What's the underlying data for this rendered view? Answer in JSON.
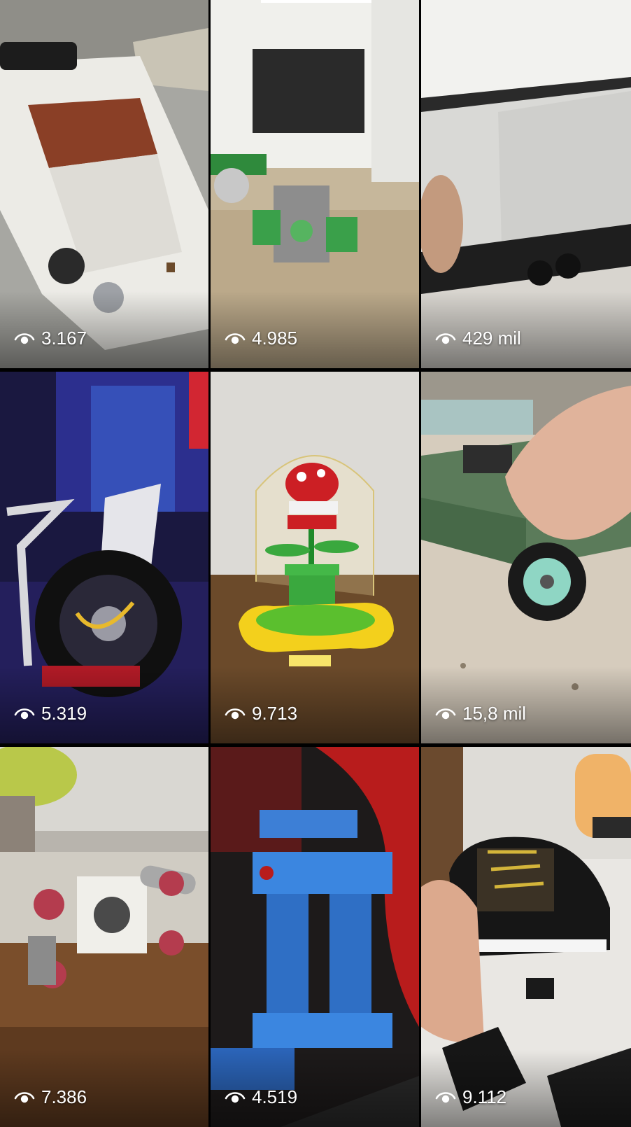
{
  "videos": [
    {
      "views": "3.167",
      "icon": "eye-icon"
    },
    {
      "views": "4.985",
      "icon": "eye-icon"
    },
    {
      "views": "429 mil",
      "icon": "eye-icon"
    },
    {
      "views": "5.319",
      "icon": "eye-icon"
    },
    {
      "views": "9.713",
      "icon": "eye-icon"
    },
    {
      "views": "15,8 mil",
      "icon": "eye-icon"
    },
    {
      "views": "7.386",
      "icon": "eye-icon"
    },
    {
      "views": "4.519",
      "icon": "eye-icon"
    },
    {
      "views": "9.112",
      "icon": "eye-icon"
    }
  ],
  "colors": {
    "background": "#000000",
    "text": "#ffffff"
  }
}
